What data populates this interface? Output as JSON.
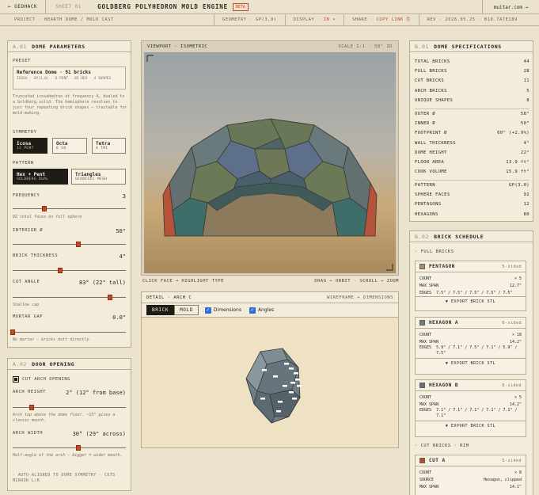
{
  "topbar": {
    "back_label": "← GEOHACK",
    "sheet": "SHEET 01 ·",
    "title": "GOLDBERG POLYHEDRON MOLD ENGINE",
    "badge": "BETA",
    "site": "muitar.com →"
  },
  "subbar": {
    "project": "PROJECT · HEARTH DOME / MOLD CAST",
    "geometry": "GEOMETRY · GP(3,0)",
    "display_label": "DISPLAY ·",
    "display_value": "IN ▾",
    "share_label": "SHARE ·",
    "share_value": "COPY LINK ⎘",
    "rev": "REV · 2026.05.25 · B10.7A7E189"
  },
  "params": {
    "num": "A.01",
    "title": "DOME PARAMETERS",
    "preset_label": "PRESET",
    "preset_title": "Reference Dome · 91 bricks",
    "preset_sub": "ICOSA · GP(3,0) · 6 PENT · 85 HEX · 4 SHAPES",
    "description": "Truncated icosahedron at frequency 4, dualed to a Goldberg solid. The hemisphere resolves to just four repeating brick shapes — tractable for mold-making.",
    "symmetry_label": "SYMMETRY",
    "symmetry": [
      {
        "t": "Icosa",
        "s": "12 PENT"
      },
      {
        "t": "Octa",
        "s": "6 SQ"
      },
      {
        "t": "Tetra",
        "s": "4 TRI"
      }
    ],
    "pattern_label": "PATTERN",
    "pattern": [
      {
        "t": "Hex + Pent",
        "s": "GOLDBERG DUAL"
      },
      {
        "t": "Triangles",
        "s": "GEODESIC MESH"
      }
    ],
    "frequency_label": "FREQUENCY",
    "frequency_value": "3",
    "frequency_note": "92 total faces on full sphere",
    "interior_label": "INTERIOR Ø",
    "interior_value": "50\"",
    "thickness_label": "BRICK THICKNESS",
    "thickness_value": "4\"",
    "cut_label": "CUT ANGLE",
    "cut_value": "83° (22\" tall)",
    "cut_note": "Shallow cap",
    "mortar_label": "MORTAR GAP",
    "mortar_value": "0.0\"",
    "mortar_note": "No mortar — bricks butt directly.",
    "sliders": {
      "frequency": 0.28,
      "interior": 0.58,
      "thickness": 0.42,
      "cut": 0.86,
      "mortar": 0.0
    }
  },
  "door": {
    "num": "A.02",
    "title": "DOOR OPENING",
    "checkbox_label": "CUT ARCH OPENING",
    "height_label": "ARCH HEIGHT",
    "height_value": "2° (12\" from base)",
    "height_note": "Arch top above the dome floor. ~15° gives a classic mouth.",
    "width_label": "ARCH WIDTH",
    "width_value": "30° (29\" across)",
    "width_note": "Half-angle of the arch — bigger = wider mouth.",
    "auto_note": "· AUTO-ALIGNED TO DOME SYMMETRY · CUTS MIRROR L/R",
    "sliders": {
      "height": 0.17,
      "width": 0.58
    }
  },
  "viewport": {
    "label": "VIEWPORT · ISOMETRIC",
    "scale": "SCALE 1:1 · 58\" ID",
    "hint_left": "CLICK FACE → HIGHLIGHT TYPE",
    "hint_right": "DRAG → ORBIT · SCROLL → ZOOM"
  },
  "detail": {
    "label": "DETAIL · ARCH C",
    "right": "WIREFRAME + DIMENSIONS",
    "tab_brick": "BRICK",
    "tab_mold": "MOLD",
    "dimensions_label": "Dimensions",
    "angles_label": "Angles"
  },
  "specs": {
    "num": "B.01",
    "title": "DOME SPECIFICATIONS",
    "group1": [
      {
        "k": "TOTAL BRICKS",
        "v": "44"
      },
      {
        "k": "FULL BRICKS",
        "v": "28"
      },
      {
        "k": "CUT BRICKS",
        "v": "11"
      },
      {
        "k": "ARCH BRICKS",
        "v": "5"
      },
      {
        "k": "UNIQUE SHAPES",
        "v": "8"
      }
    ],
    "group2": [
      {
        "k": "OUTER Ø",
        "v": "58\""
      },
      {
        "k": "INNER Ø",
        "v": "50\""
      },
      {
        "k": "FOOTPRINT Ø",
        "v": "60\" (+2.9%)"
      },
      {
        "k": "WALL THICKNESS",
        "v": "4\""
      },
      {
        "k": "DOME HEIGHT",
        "v": "22\""
      },
      {
        "k": "FLOOR AREA",
        "v": "13.9 ft²"
      },
      {
        "k": "COOK VOLUME",
        "v": "15.9 ft³"
      }
    ],
    "group3": [
      {
        "k": "PATTERN",
        "v": "GP(3,0)"
      },
      {
        "k": "SPHERE FACES",
        "v": "92"
      },
      {
        "k": "PENTAGONS",
        "v": "12"
      },
      {
        "k": "HEXAGONS",
        "v": "80"
      }
    ]
  },
  "schedule": {
    "num": "B.02",
    "title": "BRICK SCHEDULE",
    "full_label": "· FULL BRICKS",
    "cut_label": "· CUT BRICKS · RIM",
    "export_label": "▼ EXPORT BRICK STL",
    "items": [
      {
        "name": "PENTAGON",
        "sides": "5-sided",
        "count": "× 5",
        "span": "12.7\"",
        "edges": "7.5\" / 7.5\" / 7.5\" / 7.5\" / 7.5\"",
        "color": "#b58a5c"
      },
      {
        "name": "HEXAGON A",
        "sides": "6-sided",
        "count": "× 18",
        "span": "14.2\"",
        "edges": "5.9\" / 7.1\" / 7.5\" / 7.1\" / 5.9\" / 7.5\"",
        "color": "#6e7f78"
      },
      {
        "name": "HEXAGON B",
        "sides": "6-sided",
        "count": "× 5",
        "span": "14.2\"",
        "edges": "7.1\" / 7.1\" / 7.1\" / 7.1\" / 7.1\" / 7.1\"",
        "color": "#5f7186"
      }
    ],
    "cut_item": {
      "name": "CUT A",
      "sides": "5-sided",
      "count": "× 8",
      "source": "Hexagon, clipped",
      "span": "14.1\"",
      "color": "#c0492a"
    },
    "labels": {
      "count": "COUNT",
      "span": "MAX SPAN",
      "edges": "EDGES",
      "source": "SOURCE"
    }
  }
}
